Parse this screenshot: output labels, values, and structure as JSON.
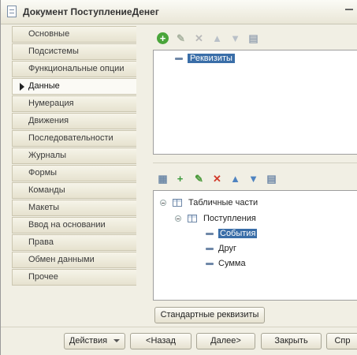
{
  "window": {
    "title": "Документ ПоступлениеДенег"
  },
  "tabs": [
    {
      "label": "Основные"
    },
    {
      "label": "Подсистемы"
    },
    {
      "label": "Функциональные опции"
    },
    {
      "label": "Данные"
    },
    {
      "label": "Нумерация"
    },
    {
      "label": "Движения"
    },
    {
      "label": "Последовательности"
    },
    {
      "label": "Журналы"
    },
    {
      "label": "Формы"
    },
    {
      "label": "Команды"
    },
    {
      "label": "Макеты"
    },
    {
      "label": "Ввод на основании"
    },
    {
      "label": "Права"
    },
    {
      "label": "Обмен данными"
    },
    {
      "label": "Прочее"
    }
  ],
  "active_tab": "Данные",
  "attributes_panel": {
    "items": [
      {
        "label": "Реквизиты"
      }
    ]
  },
  "tabular_panel": {
    "root": "Табличные части",
    "table": "Поступления",
    "columns": [
      {
        "label": "События"
      },
      {
        "label": "Друг"
      },
      {
        "label": "Сумма"
      }
    ]
  },
  "standard_attrs_button": "Стандартные реквизиты",
  "footer": {
    "actions": "Действия",
    "back": "<Назад",
    "next": "Далее>",
    "close": "Закрыть",
    "help": "Спр"
  },
  "colors": {
    "selection": "#3a6ea8",
    "tree_icon": "#6f88a8",
    "window_bg": "#f1efe4"
  }
}
